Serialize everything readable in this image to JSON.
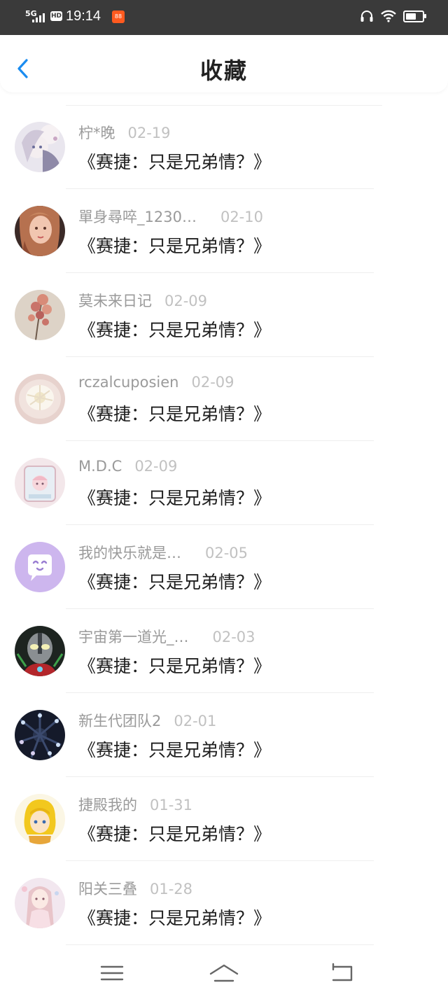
{
  "status_bar": {
    "network": "5G",
    "hd_label": "HD",
    "time": "19:14",
    "app_badge": "88",
    "battery_level": 0.65
  },
  "header": {
    "title": "收藏"
  },
  "favorites": [
    {
      "user": "柠*晚",
      "date": "02-19",
      "title": "《赛捷：只是兄弟情？》"
    },
    {
      "user": "單身尋啐_1230…",
      "date": "02-10",
      "title": "《赛捷：只是兄弟情？》"
    },
    {
      "user": "莫未来日记",
      "date": "02-09",
      "title": "《赛捷：只是兄弟情？》"
    },
    {
      "user": "rczalcuposien",
      "date": "02-09",
      "title": "《赛捷：只是兄弟情？》"
    },
    {
      "user": "M.D.C",
      "date": "02-09",
      "title": "《赛捷：只是兄弟情？》"
    },
    {
      "user": "我的快乐就是…",
      "date": "02-05",
      "title": "《赛捷：只是兄弟情？》"
    },
    {
      "user": "宇宙第一道光_…",
      "date": "02-03",
      "title": "《赛捷：只是兄弟情？》"
    },
    {
      "user": "新生代团队2",
      "date": "02-01",
      "title": "《赛捷：只是兄弟情？》"
    },
    {
      "user": "捷殿我的",
      "date": "01-31",
      "title": "《赛捷：只是兄弟情？》"
    },
    {
      "user": "阳关三叠",
      "date": "01-28",
      "title": "《赛捷：只是兄弟情？》"
    }
  ],
  "nav_bar": {
    "icons": [
      "menu-icon",
      "home-icon",
      "back-icon"
    ]
  },
  "colors": {
    "accent": "#1a8cf0",
    "status_bar_bg": "#3a3a3a",
    "username": "#9a9a9a",
    "date": "#c1c1c1",
    "title_text": "#1e1e1e"
  }
}
